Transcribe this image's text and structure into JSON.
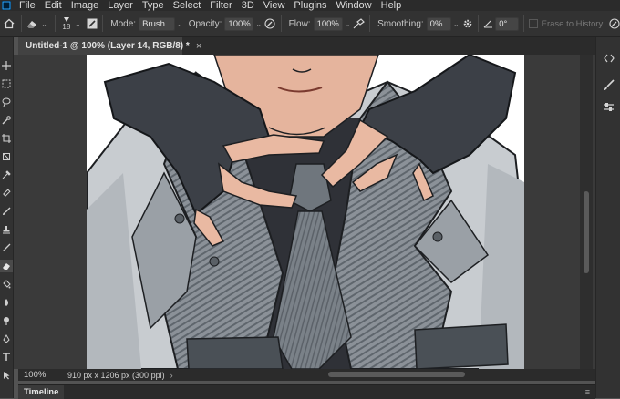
{
  "menu": {
    "logo": "photoshop-logo",
    "items": [
      "File",
      "Edit",
      "Image",
      "Layer",
      "Type",
      "Select",
      "Filter",
      "3D",
      "View",
      "Plugins",
      "Window",
      "Help"
    ]
  },
  "options": {
    "brush_size": "18",
    "mode_label": "Mode:",
    "mode_value": "Brush",
    "opacity_label": "Opacity:",
    "opacity_value": "100%",
    "flow_label": "Flow:",
    "flow_value": "100%",
    "smoothing_label": "Smoothing:",
    "smoothing_value": "0%",
    "angle_value": "0°",
    "erase_to_history": "Erase to History"
  },
  "document": {
    "tab_title": "Untitled-1 @ 100% (Layer 14, RGB/8) *",
    "close": "×"
  },
  "status": {
    "zoom": "100%",
    "doc_info": "910 px x 1206 px (300 ppi)",
    "chevron": "›"
  },
  "timeline": {
    "label": "Timeline"
  },
  "colors": {
    "app_bg": "#535353",
    "panel": "#323232",
    "dark": "#2b2b2b",
    "glove": "#3c4047",
    "suit": "#c4c8cc",
    "stripe": "#7d848b",
    "shirt": "#2f3137",
    "skin": "#e9b9a2"
  }
}
